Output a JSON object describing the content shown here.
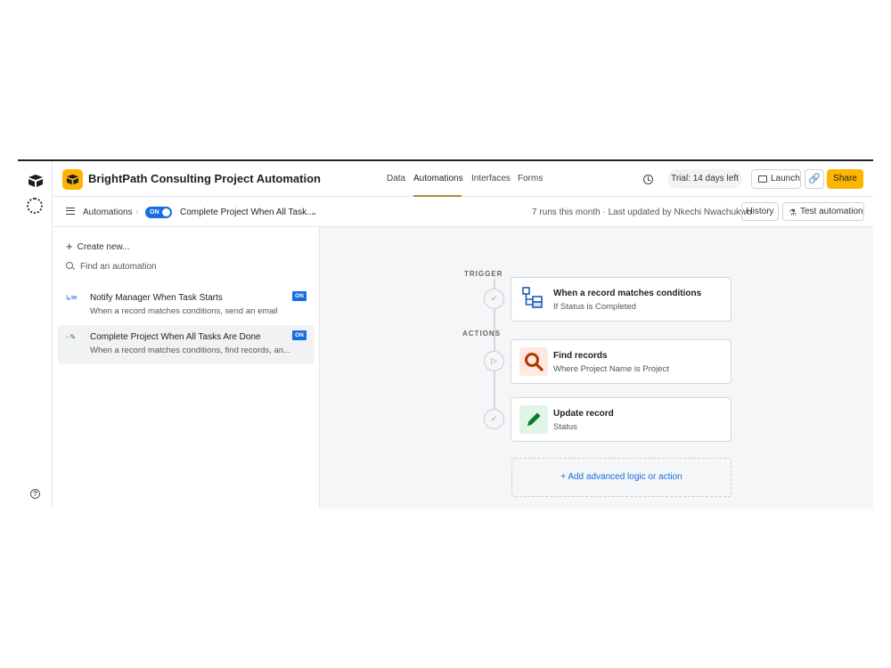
{
  "app": {
    "title": "BrightPath Consulting Project Automation",
    "brand_color": "#fcb400",
    "accent": "#166ee1"
  },
  "nav": {
    "items": [
      "Data",
      "Automations",
      "Interfaces",
      "Forms"
    ],
    "active": "Automations"
  },
  "header": {
    "trial": "Trial: 14 days left",
    "launch": "Launch",
    "share": "Share"
  },
  "subheader": {
    "breadcrumb": "Automations",
    "toggle": "ON",
    "automation_name": "Complete Project When All Task...",
    "meta": "7 runs this month · Last updated by Nkechi Nwachukwu",
    "history": "History",
    "test": "Test automation"
  },
  "sidebar": {
    "create": "Create new...",
    "find": "Find an automation",
    "items": [
      {
        "name": "Notify Manager When Task Starts",
        "desc": "When a record matches conditions, send an email",
        "status": "ON",
        "icon": "trigger-email-icon"
      },
      {
        "name": "Complete Project When All Tasks Are Done",
        "desc": "When a record matches conditions, find records, an...",
        "status": "ON",
        "icon": "trigger-edit-icon"
      }
    ]
  },
  "canvas": {
    "trigger_label": "TRIGGER",
    "actions_label": "ACTIONS",
    "trigger": {
      "title": "When a record matches conditions",
      "subtitle": "If Status is Completed",
      "icon": "conditions-icon"
    },
    "actions": [
      {
        "title": "Find records",
        "subtitle": "Where Project Name is Project",
        "icon": "magnifier-icon",
        "color": "#b33600"
      },
      {
        "title": "Update record",
        "subtitle": "Status",
        "icon": "pencil-icon",
        "color": "#0b7a2a"
      }
    ],
    "add": "Add advanced logic or action"
  }
}
